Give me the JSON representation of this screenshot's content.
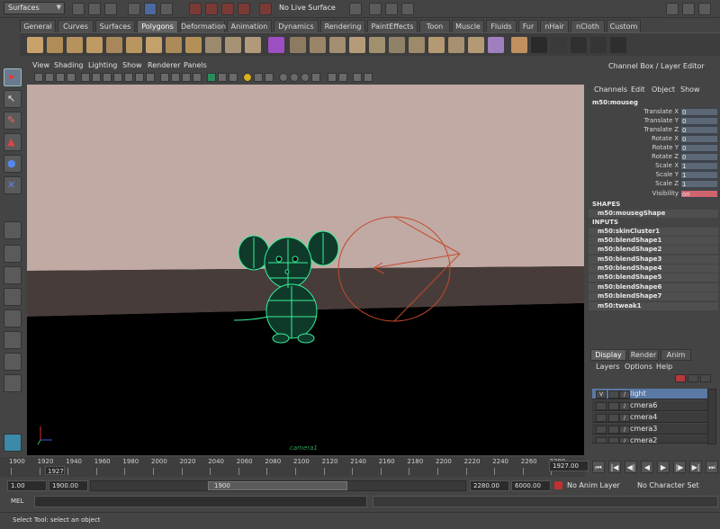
{
  "status_line": {
    "menu_set": "Surfaces",
    "live_surface": "No Live Surface"
  },
  "shelf_tabs": [
    "General",
    "Curves",
    "Surfaces",
    "Polygons",
    "Deformation",
    "Animation",
    "Dynamics",
    "Rendering",
    "PaintEffects",
    "Toon",
    "Muscle",
    "Fluids",
    "Fur",
    "nHair",
    "nCloth",
    "Custom"
  ],
  "active_shelf_tab": "Polygons",
  "viewport": {
    "menus": [
      "View",
      "Shading",
      "Lighting",
      "Show",
      "Renderer",
      "Panels"
    ],
    "camera_label": "camera1",
    "floor_color": "#483c3a",
    "backdrop_color": "#c1aaa4",
    "wire_color": "#38f09b",
    "camera_wire_color": "#c24a2c"
  },
  "channel_box": {
    "title": "Channel Box / Layer Editor",
    "menus": [
      "Channels",
      "Edit",
      "Object",
      "Show"
    ],
    "object": "m50:mouseg",
    "attributes": [
      {
        "label": "Translate X",
        "value": "0"
      },
      {
        "label": "Translate Y",
        "value": "0"
      },
      {
        "label": "Translate Z",
        "value": "0"
      },
      {
        "label": "Rotate X",
        "value": "0"
      },
      {
        "label": "Rotate Y",
        "value": "0"
      },
      {
        "label": "Rotate Z",
        "value": "0"
      },
      {
        "label": "Scale X",
        "value": "1"
      },
      {
        "label": "Scale Y",
        "value": "1"
      },
      {
        "label": "Scale Z",
        "value": "1"
      },
      {
        "label": "Visibility",
        "value": "on"
      }
    ],
    "shapes_header": "SHAPES",
    "shape": "m50:mousegShape",
    "inputs_header": "INPUTS",
    "inputs": [
      "m50:skinCluster1",
      "m50:blendShape1",
      "m50:blendShape2",
      "m50:blendShape3",
      "m50:blendShape4",
      "m50:blendShape5",
      "m50:blendShape6",
      "m50:blendShape7",
      "m50:tweak1"
    ]
  },
  "layer_editor": {
    "tabs": [
      "Display",
      "Render",
      "Anim"
    ],
    "active_tab": "Display",
    "menus": [
      "Layers",
      "Options",
      "Help"
    ],
    "layers": [
      {
        "name": "light",
        "visible": "V",
        "selected": true
      },
      {
        "name": "cmera6",
        "visible": "",
        "selected": false
      },
      {
        "name": "cmera4",
        "visible": "",
        "selected": false
      },
      {
        "name": "cmera3",
        "visible": "",
        "selected": false
      },
      {
        "name": "cmera2",
        "visible": "",
        "selected": false
      }
    ]
  },
  "time_slider": {
    "ticks": [
      "1900",
      "1920",
      "1940",
      "1960",
      "1980",
      "2000",
      "2020",
      "2040",
      "2060",
      "2080",
      "2100",
      "2120",
      "2140",
      "2160",
      "2180",
      "2200",
      "2220",
      "2240",
      "2260",
      "2280"
    ],
    "current_frame": "1927",
    "current_time_field": "1927.00"
  },
  "range_slider": {
    "start_time": "1.00",
    "playback_start": "1900.00",
    "range_handle_label": "1900",
    "playback_end": "2280.00",
    "end_time": "6000.00",
    "anim_layer": "No Anim Layer",
    "character_set": "No Character Set"
  },
  "command_line": {
    "label": "MEL"
  },
  "help_line": {
    "text": "Select Tool: select an object"
  }
}
